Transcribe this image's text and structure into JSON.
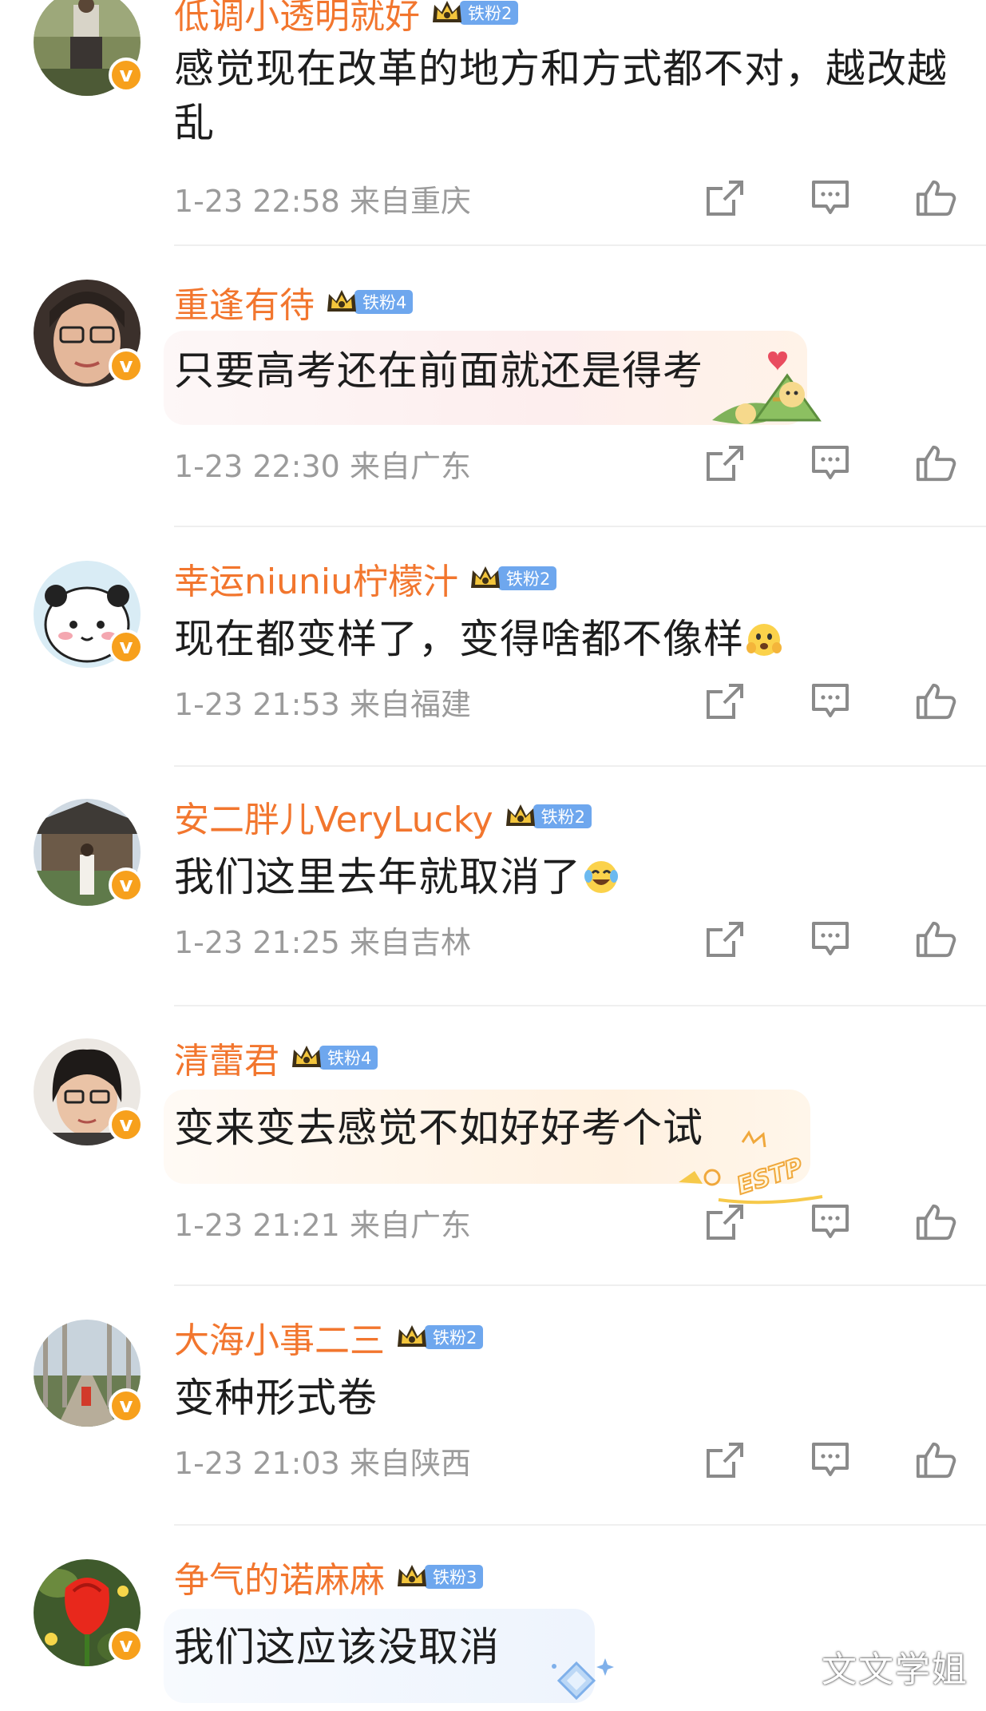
{
  "comments": [
    {
      "username": "低调小透明就好",
      "fan_level": "铁粉2",
      "text": "感觉现在改革的地方和方式都不对，越改越乱",
      "time": "1-23 22:58",
      "location": "来自重庆"
    },
    {
      "username": "重逢有待",
      "fan_level": "铁粉4",
      "text": "只要高考还在前面就还是得考",
      "time": "1-23 22:30",
      "location": "来自广东"
    },
    {
      "username": "幸运niuniu柠檬汁",
      "fan_level": "铁粉2",
      "text": "现在都变样了，变得啥都不像样",
      "time": "1-23 21:53",
      "location": "来自福建"
    },
    {
      "username": "安二胖儿VeryLucky",
      "fan_level": "铁粉2",
      "text": "我们这里去年就取消了",
      "time": "1-23 21:25",
      "location": "来自吉林"
    },
    {
      "username": "清蕾君",
      "fan_level": "铁粉4",
      "text": "变来变去感觉不如好好考个试",
      "bubble_sticker_text": "ESTP",
      "time": "1-23 21:21",
      "location": "来自广东"
    },
    {
      "username": "大海小事二三",
      "fan_level": "铁粉2",
      "text": "变种形式卷",
      "time": "1-23 21:03",
      "location": "来自陕西"
    },
    {
      "username": "争气的诺麻麻",
      "fan_level": "铁粉3",
      "text": "我们这应该没取消"
    }
  ],
  "verified_badge": "v",
  "icons": {
    "share": "share-icon",
    "reply": "comment-icon",
    "like": "like-icon",
    "crown": "crown-icon"
  },
  "colors": {
    "username": "#f2762e",
    "fan_tag": "#6ea7ee",
    "verified": "#f7a01c",
    "meta": "#9b9b9b"
  },
  "watermark": "文文学姐"
}
